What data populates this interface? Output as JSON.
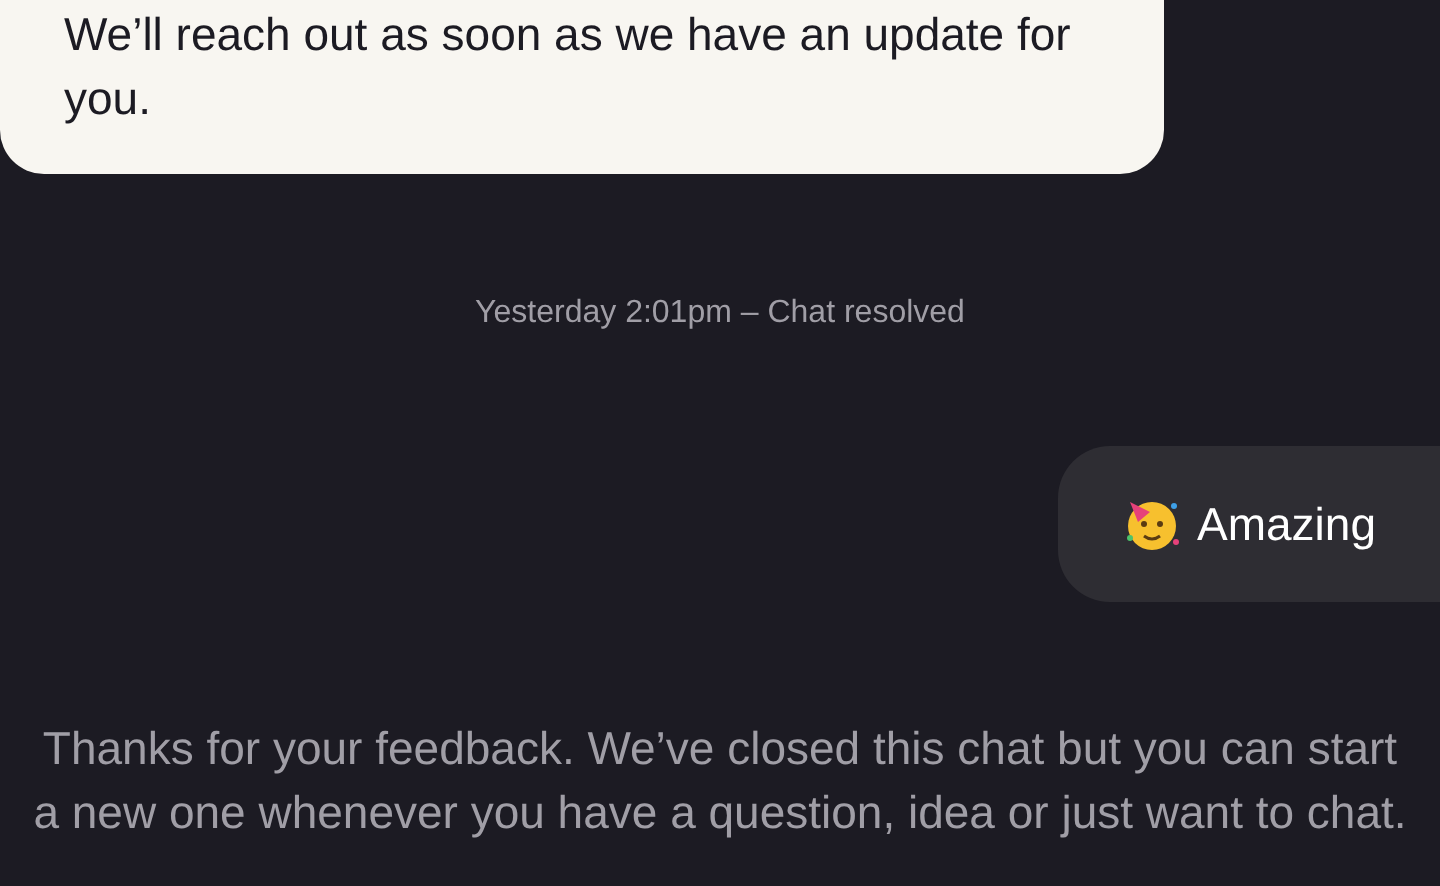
{
  "messages": [
    {
      "kind": "agent",
      "text": "We’ll reach out as soon as we have an update for you."
    },
    {
      "kind": "status",
      "text": "Yesterday 2:01pm – Chat resolved"
    },
    {
      "kind": "user",
      "text": "Amazing"
    },
    {
      "kind": "notice",
      "text": "Thanks for your feedback. We’ve closed this chat but you can start a new one whenever you have a question, idea or just want to chat."
    }
  ]
}
